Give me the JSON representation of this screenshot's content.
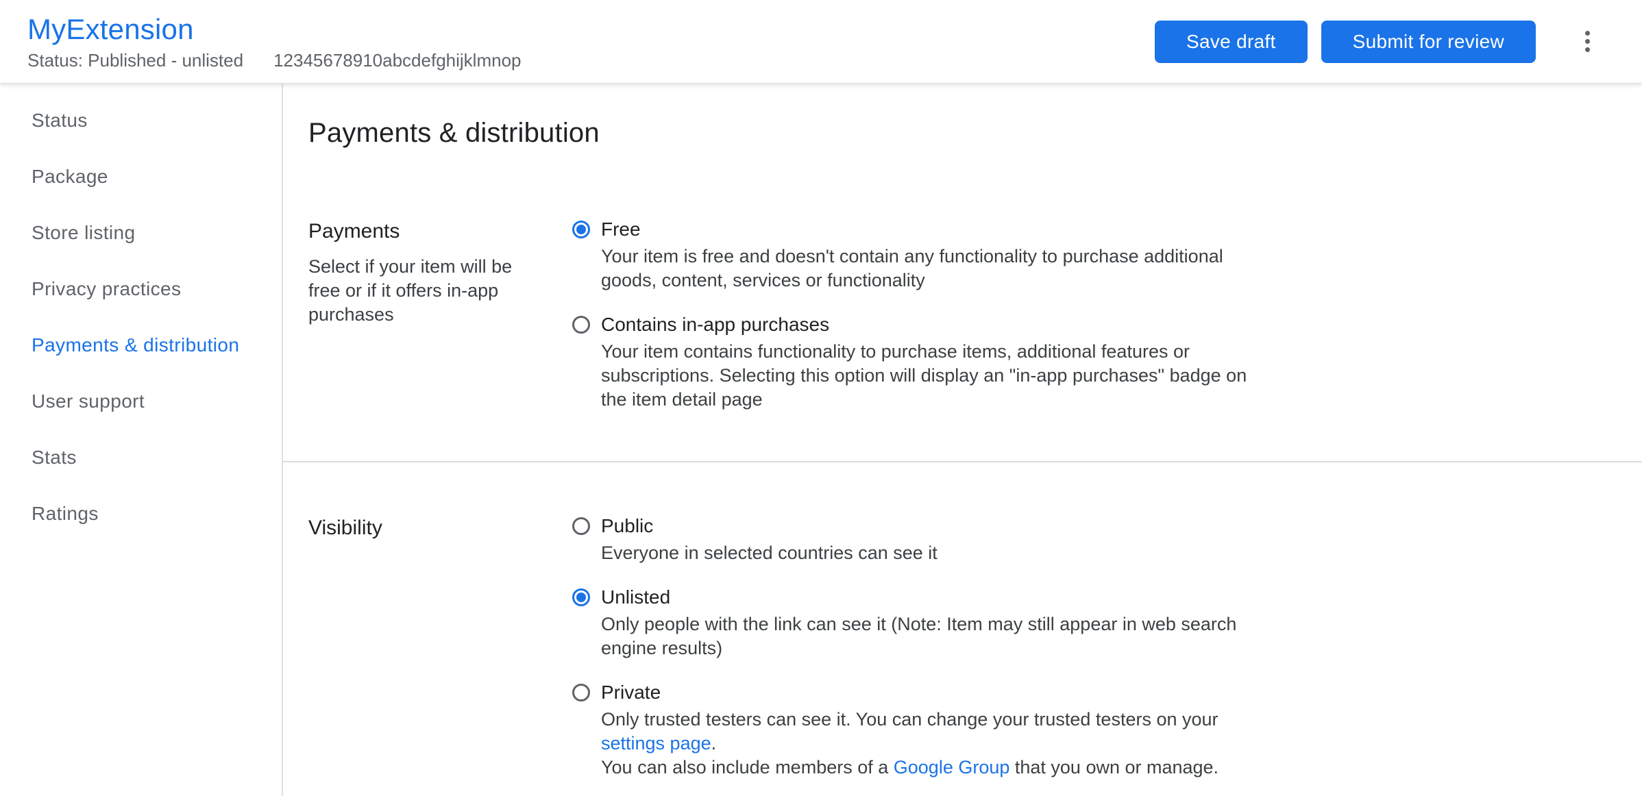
{
  "header": {
    "title": "MyExtension",
    "status": "Status: Published - unlisted",
    "extension_id": "12345678910abcdefghijklmnop",
    "save_draft_label": "Save draft",
    "submit_label": "Submit for review"
  },
  "sidebar": {
    "items": [
      {
        "label": "Status",
        "active": false
      },
      {
        "label": "Package",
        "active": false
      },
      {
        "label": "Store listing",
        "active": false
      },
      {
        "label": "Privacy practices",
        "active": false
      },
      {
        "label": "Payments & distribution",
        "active": true
      },
      {
        "label": "User support",
        "active": false
      },
      {
        "label": "Stats",
        "active": false
      },
      {
        "label": "Ratings",
        "active": false
      }
    ]
  },
  "main": {
    "page_title": "Payments & distribution",
    "payments_section": {
      "label": "Payments",
      "description": "Select if your item will be\nfree or if it offers in-app\npurchases",
      "options": [
        {
          "label": "Free",
          "selected": true,
          "description": "Your item is free and doesn't contain any functionality to purchase additional\ngoods, content, services or functionality"
        },
        {
          "label": "Contains in-app purchases",
          "selected": false,
          "description": "Your item contains functionality to purchase items, additional features or\nsubscriptions. Selecting this option will display an \"in-app purchases\" badge on\nthe item detail page"
        }
      ]
    },
    "visibility_section": {
      "label": "Visibility",
      "options": [
        {
          "label": "Public",
          "selected": false,
          "description": "Everyone in selected countries can see it"
        },
        {
          "label": "Unlisted",
          "selected": true,
          "description": "Only people with the link can see it (Note: Item may still appear in web search\nengine results)"
        },
        {
          "label": "Private",
          "selected": false,
          "description_segments": [
            {
              "text": "Only trusted testers can see it. You can change your trusted testers on your\n",
              "link": false
            },
            {
              "text": "settings page",
              "link": true
            },
            {
              "text": ".\nYou can also include members of a ",
              "link": false
            },
            {
              "text": "Google Group",
              "link": true
            },
            {
              "text": " that you own or manage.",
              "link": false
            }
          ]
        }
      ]
    }
  },
  "colors": {
    "accent_blue": "#1a73e8",
    "text_primary": "#202124",
    "text_secondary": "#5f6368",
    "divider": "#dadce0"
  }
}
